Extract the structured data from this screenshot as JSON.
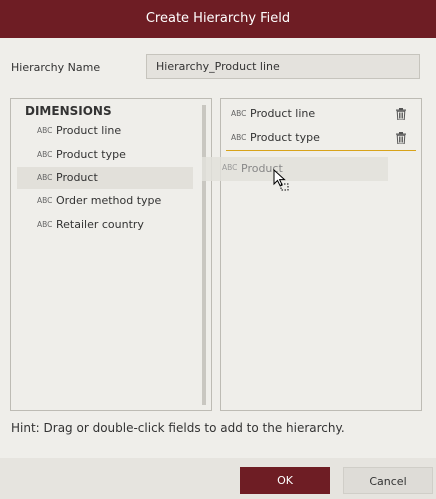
{
  "dialog": {
    "title": "Create Hierarchy Field"
  },
  "hierarchy_name": {
    "label": "Hierarchy Name",
    "value": "Hierarchy_Product line"
  },
  "dimensions": {
    "header": "DIMENSIONS",
    "type_badge": "ABC",
    "items": [
      {
        "label": "Product line"
      },
      {
        "label": "Product type"
      },
      {
        "label": "Product"
      },
      {
        "label": "Order method type"
      },
      {
        "label": "Retailer country"
      }
    ],
    "selected_item": "Product"
  },
  "hierarchy_levels": {
    "type_badge": "ABC",
    "items": [
      {
        "label": "Product line"
      },
      {
        "label": "Product type"
      }
    ]
  },
  "drag_ghost": {
    "type_badge": "ABC",
    "label": "Product"
  },
  "hint": "Hint: Drag or double-click fields to add to the hierarchy.",
  "buttons": {
    "ok": "OK",
    "cancel": "Cancel"
  },
  "colors": {
    "accent": "#6e1d24",
    "drop_indicator": "#d8a31a",
    "background": "#efeeea"
  }
}
